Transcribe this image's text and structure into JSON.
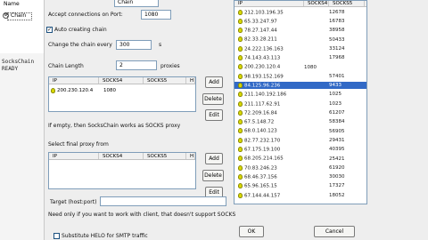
{
  "tree": {
    "name_header": "Name",
    "node_label": "Chain"
  },
  "console": {
    "lines": [
      "SocksChain",
      "READY"
    ]
  },
  "dialog": {
    "name_value": "Chain",
    "accept_label": "Accept connections on Port:",
    "port_value": "1080",
    "auto_chain_label": "Auto creating chain",
    "auto_chain_checked": true,
    "change_label": "Change the chain every",
    "change_value": "300",
    "change_unit": "s",
    "chain_length_label": "Chain Length",
    "chain_length_value": "2",
    "proxies_label": "proxies",
    "chain_grid": {
      "headers": [
        "IP",
        "SOCKS4",
        "SOCKS5",
        "H"
      ],
      "rows": [
        {
          "ip": "200.230.120.4",
          "s4": "1080"
        }
      ]
    },
    "chain_buttons": {
      "add": "Add",
      "delete": "Delete",
      "edit": "Edit"
    },
    "empty_note": "If empty, then SocksChain works as SOCKS proxy",
    "final_label": "Select final proxy from",
    "final_grid": {
      "headers": [
        "IP",
        "SOCKS4",
        "SOCKS5",
        "H"
      ]
    },
    "final_buttons": {
      "add": "Add",
      "delete": "Delete",
      "edit": "Edit"
    },
    "target_label": "Target (host:port)",
    "need_note": "Need only if you want to work with client, that doesn't support SOCKS",
    "substitute_label": "Substitute HELO for SMTP traffic",
    "substitute_checked": false,
    "ok": "OK",
    "cancel": "Cancel"
  },
  "proxy_list": {
    "headers": [
      "IP",
      "SOCKS4",
      "SOCKS5"
    ],
    "rows": [
      {
        "ip": "212.103.196.35",
        "s4": "",
        "s5": "12678"
      },
      {
        "ip": "65.33.247.97",
        "s4": "",
        "s5": "16783"
      },
      {
        "ip": "78.27.147.44",
        "s4": "",
        "s5": "38958"
      },
      {
        "ip": "82.33.28.211",
        "s4": "",
        "s5": "50433"
      },
      {
        "ip": "24.222.136.163",
        "s4": "",
        "s5": "33124"
      },
      {
        "ip": "74.143.43.113",
        "s4": "",
        "s5": "17968"
      },
      {
        "ip": "200.230.120.4",
        "s4": "1080",
        "s5": ""
      },
      {
        "ip": "98.193.152.169",
        "s4": "",
        "s5": "57401"
      },
      {
        "ip": "84.125.96.236",
        "s4": "",
        "s5": "9433",
        "selected": true
      },
      {
        "ip": "211.140.192.186",
        "s4": "",
        "s5": "1025"
      },
      {
        "ip": "211.117.62.91",
        "s4": "",
        "s5": "1023"
      },
      {
        "ip": "72.209.16.84",
        "s4": "",
        "s5": "61207"
      },
      {
        "ip": "67.5.148.72",
        "s4": "",
        "s5": "58384"
      },
      {
        "ip": "68.0.140.123",
        "s4": "",
        "s5": "56905"
      },
      {
        "ip": "82.77.232.170",
        "s4": "",
        "s5": "29431"
      },
      {
        "ip": "67.175.19.100",
        "s4": "",
        "s5": "40395"
      },
      {
        "ip": "68.205.214.165",
        "s4": "",
        "s5": "25421"
      },
      {
        "ip": "70.83.246.23",
        "s4": "",
        "s5": "61920"
      },
      {
        "ip": "68.46.37.156",
        "s4": "",
        "s5": "30030"
      },
      {
        "ip": "65.96.165.15",
        "s4": "",
        "s5": "17327"
      },
      {
        "ip": "67.144.44.157",
        "s4": "",
        "s5": "18052"
      }
    ]
  }
}
